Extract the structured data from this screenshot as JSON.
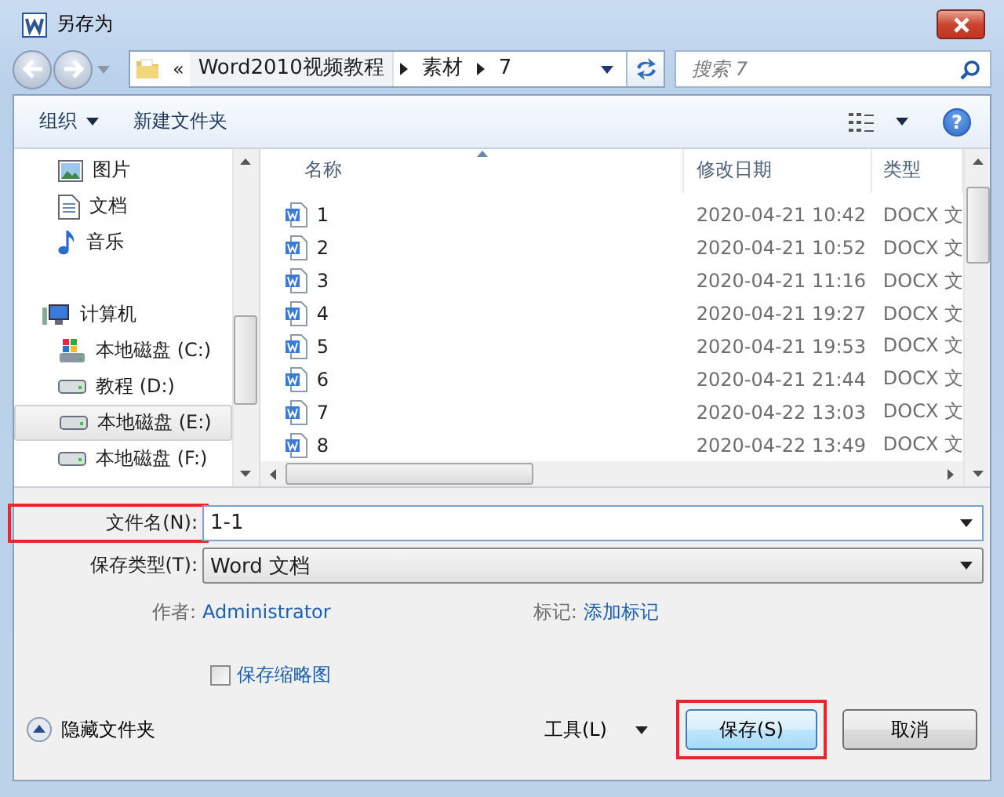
{
  "window": {
    "title": "另存为"
  },
  "address": {
    "overflow": "«",
    "segments": [
      "Word2010视频教程",
      "素材",
      "7"
    ]
  },
  "search": {
    "placeholder": "搜索 7"
  },
  "toolbar": {
    "organize": "组织",
    "new_folder": "新建文件夹",
    "help": "?"
  },
  "sidebar": {
    "items": [
      {
        "label": "图片",
        "kind": "pictures",
        "selected": false
      },
      {
        "label": "文档",
        "kind": "documents",
        "selected": false
      },
      {
        "label": "音乐",
        "kind": "music",
        "selected": false
      },
      {
        "label": "计算机",
        "kind": "computer",
        "selected": false
      },
      {
        "label": "本地磁盘 (C:)",
        "kind": "system_drive",
        "selected": false
      },
      {
        "label": "教程 (D:)",
        "kind": "drive",
        "selected": false
      },
      {
        "label": "本地磁盘 (E:)",
        "kind": "drive",
        "selected": true
      },
      {
        "label": "本地磁盘 (F:)",
        "kind": "drive",
        "selected": false
      }
    ]
  },
  "table": {
    "columns": [
      {
        "label": "名称",
        "sorted": true
      },
      {
        "label": "修改日期",
        "sorted": false
      },
      {
        "label": "类型",
        "sorted": false
      }
    ],
    "rows": [
      {
        "name": "1",
        "modified": "2020-04-21 10:42",
        "type": "DOCX 文"
      },
      {
        "name": "2",
        "modified": "2020-04-21 10:52",
        "type": "DOCX 文"
      },
      {
        "name": "3",
        "modified": "2020-04-21 11:16",
        "type": "DOCX 文"
      },
      {
        "name": "4",
        "modified": "2020-04-21 19:27",
        "type": "DOCX 文"
      },
      {
        "name": "5",
        "modified": "2020-04-21 19:53",
        "type": "DOCX 文"
      },
      {
        "name": "6",
        "modified": "2020-04-21 21:44",
        "type": "DOCX 文"
      },
      {
        "name": "7",
        "modified": "2020-04-22 13:03",
        "type": "DOCX 文"
      },
      {
        "name": "8",
        "modified": "2020-04-22 13:49",
        "type": "DOCX 文"
      }
    ]
  },
  "form": {
    "file_name": {
      "label": "文件名(N):",
      "value": "1-1",
      "highlighted": true
    },
    "save_type": {
      "label": "保存类型(T):",
      "value": "Word 文档"
    },
    "author": {
      "label": "作者:",
      "value": "Administrator"
    },
    "tags": {
      "label": "标记:",
      "value": "添加标记"
    },
    "thumbnail": {
      "label": "保存缩略图",
      "checked": false
    }
  },
  "footer": {
    "hide_folders": "隐藏文件夹",
    "tools": "工具(L)",
    "buttons": [
      {
        "label": "保存(S)",
        "kind": "primary",
        "highlighted": true
      },
      {
        "label": "取消",
        "kind": "normal",
        "highlighted": false
      }
    ]
  }
}
